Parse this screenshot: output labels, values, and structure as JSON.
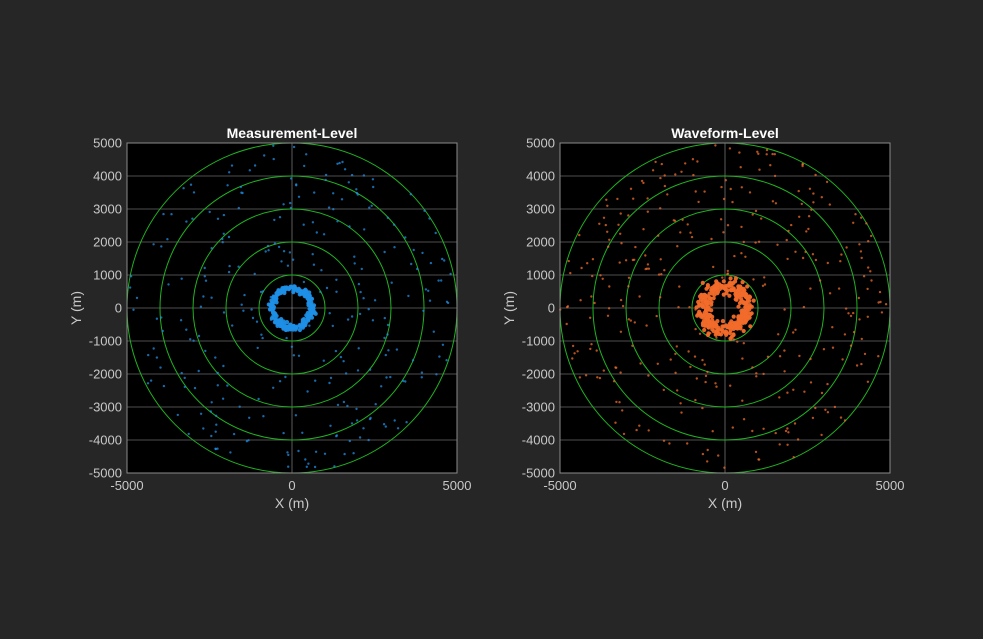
{
  "colors": {
    "figure_background": "#262626",
    "axes_background": "#000000",
    "grid": "#d0d0d0",
    "range_rings": "#1fb21f",
    "text": "#c8c8c8",
    "title": "#ffffff"
  },
  "chart_data": [
    {
      "type": "scatter",
      "title": "Measurement-Level",
      "xlabel": "X (m)",
      "ylabel": "Y (m)",
      "xlim": [
        -5000,
        5000
      ],
      "ylim": [
        -5000,
        5000
      ],
      "xticks": [
        -5000,
        0,
        5000
      ],
      "xtick_labels": [
        "-5000",
        "0",
        "5000"
      ],
      "yticks": [
        5000,
        4000,
        3000,
        2000,
        1000,
        0,
        -1000,
        -2000,
        -3000,
        -4000,
        -5000
      ],
      "ytick_labels": [
        "5000",
        "4000",
        "3000",
        "2000",
        "1000",
        "0",
        "-1000",
        "-2000",
        "-3000",
        "-4000",
        "-5000"
      ],
      "grid": true,
      "range_rings": [
        1000,
        2000,
        3000,
        4000,
        5000
      ],
      "series": [
        {
          "color": "#1f8fe6",
          "dense_ring": {
            "center": [
              0,
              0
            ],
            "radius": 600,
            "spread": 50,
            "count": 220
          },
          "scattered": {
            "r_min": 600,
            "r_max": 5000,
            "count": 290
          }
        }
      ]
    },
    {
      "type": "scatter",
      "title": "Waveform-Level",
      "xlabel": "X (m)",
      "ylabel": "Y (m)",
      "xlim": [
        -5000,
        5000
      ],
      "ylim": [
        -5000,
        5000
      ],
      "xticks": [
        -5000,
        0,
        5000
      ],
      "xtick_labels": [
        "-5000",
        "0",
        "5000"
      ],
      "yticks": [
        5000,
        4000,
        3000,
        2000,
        1000,
        0,
        -1000,
        -2000,
        -3000,
        -4000,
        -5000
      ],
      "ytick_labels": [
        "5000",
        "4000",
        "3000",
        "2000",
        "1000",
        "0",
        "-1000",
        "-2000",
        "-3000",
        "-4000",
        "-5000"
      ],
      "grid": true,
      "range_rings": [
        1000,
        2000,
        3000,
        4000,
        5000
      ],
      "series": [
        {
          "color": "#f26b2a",
          "dense_ring": {
            "center": [
              0,
              0
            ],
            "radius": 680,
            "spread": 120,
            "count": 320
          },
          "scattered": {
            "r_min": 700,
            "r_max": 5000,
            "count": 330
          }
        }
      ]
    }
  ]
}
